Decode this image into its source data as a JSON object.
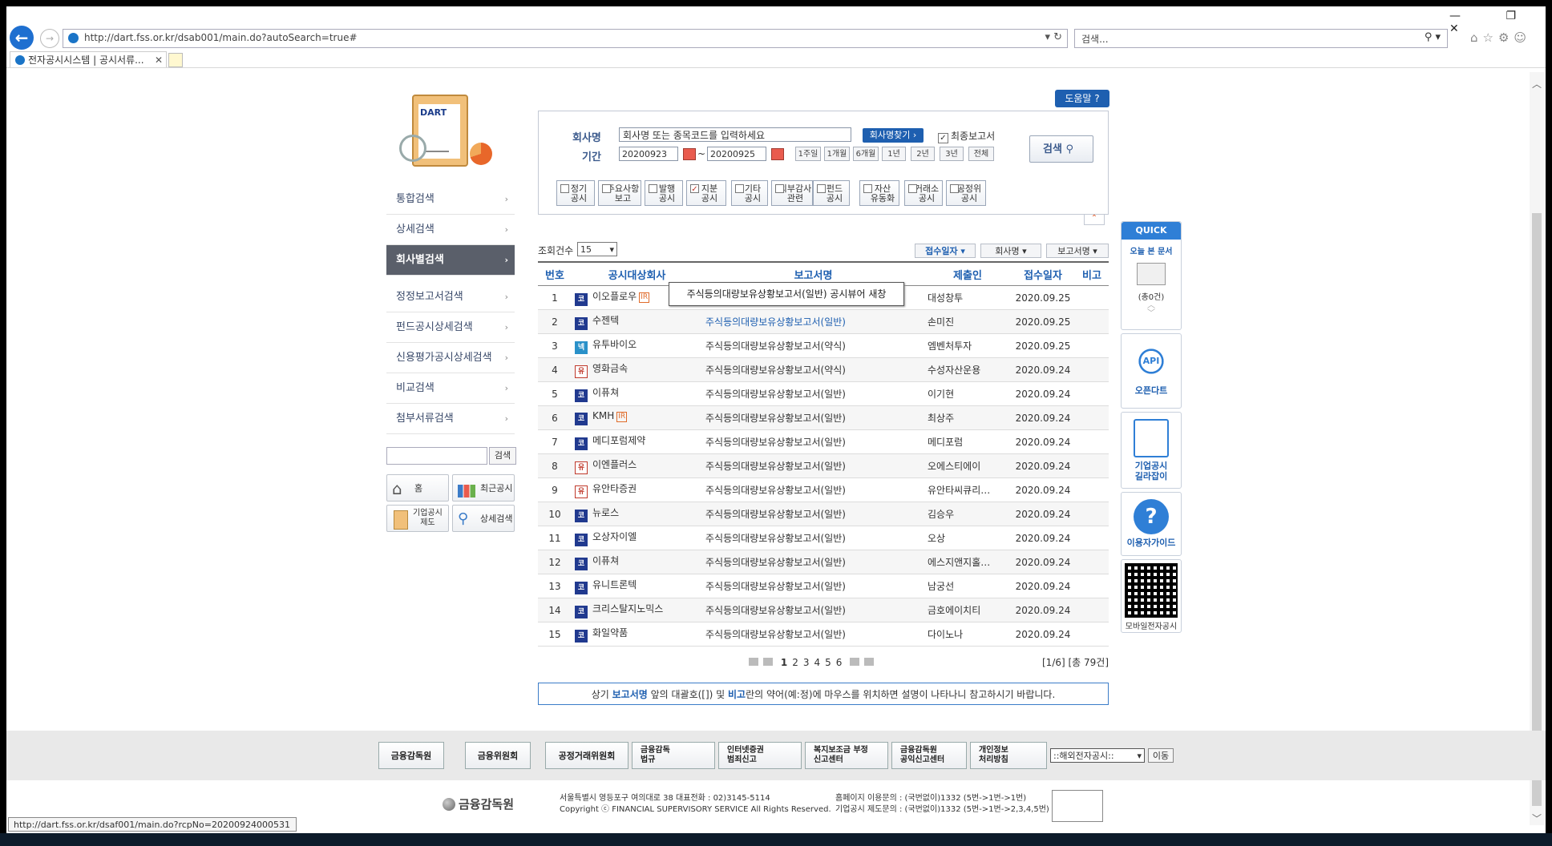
{
  "browser": {
    "url": "http://dart.fss.or.kr/dsab001/main.do?autoSearch=true#",
    "search_placeholder": "검색...",
    "tab_title": "전자공시시스템 | 공시서류...",
    "status_url": "http://dart.fss.or.kr/dsaf001/main.do?rcpNo=20200924000531"
  },
  "logo": {
    "text": "DART"
  },
  "sidebar": {
    "items": [
      {
        "label": "통합검색"
      },
      {
        "label": "상세검색"
      },
      {
        "label": "회사별검색"
      },
      {
        "label": "정정보고서검색"
      },
      {
        "label": "펀드공시상세검색"
      },
      {
        "label": "신용평가공시상세검색"
      },
      {
        "label": "비교검색"
      },
      {
        "label": "첨부서류검색"
      }
    ],
    "search_button": "검색",
    "quick": [
      {
        "label": "홈",
        "icon": "home-icon"
      },
      {
        "label": "최근공시",
        "icon": "bar-chart-icon"
      },
      {
        "label": "기업공시\n제도",
        "icon": "clipboard-icon"
      },
      {
        "label": "상세검색",
        "icon": "magnifier-icon"
      }
    ]
  },
  "search": {
    "help_label": "도움말",
    "company_label": "회사명",
    "company_placeholder": "회사명 또는 종목코드를 입력하세요",
    "find_company": "회사명찾기",
    "final_report": "최종보고서",
    "period_label": "기간",
    "date_from": "20200923",
    "date_to": "20200925",
    "tilde": "~",
    "periods": [
      "1주일",
      "1개월",
      "6개월",
      "1년",
      "2년",
      "3년",
      "전체"
    ],
    "search_button": "검색",
    "types": [
      {
        "l1": "정기",
        "l2": "공시",
        "checked": false
      },
      {
        "l1": "주요사항",
        "l2": "보고",
        "checked": false
      },
      {
        "l1": "발행",
        "l2": "공시",
        "checked": false
      },
      {
        "l1": "지분",
        "l2": "공시",
        "checked": true
      },
      {
        "l1": "기타",
        "l2": "공시",
        "checked": false
      },
      {
        "l1": "외부감사",
        "l2": "관련",
        "checked": false
      },
      {
        "l1": "펀드",
        "l2": "공시",
        "checked": false
      },
      {
        "l1": "자산",
        "l2": "유동화",
        "checked": false
      },
      {
        "l1": "거래소",
        "l2": "공시",
        "checked": false
      },
      {
        "l1": "공정위",
        "l2": "공시",
        "checked": false
      }
    ]
  },
  "results": {
    "count_label": "조회건수",
    "count_value": "15",
    "sort": [
      "접수일자",
      "회사명",
      "보고서명"
    ],
    "headers": [
      "번호",
      "공시대상회사",
      "보고서명",
      "제출인",
      "접수일자",
      "비고"
    ],
    "tooltip": "주식등의대량보유상황보고서(일반) 공시뷰어 새창",
    "rows": [
      {
        "no": "1",
        "mk": "코",
        "mkc": "k",
        "company": "이오플로우",
        "ir": true,
        "report": "",
        "submitter": "대성창투",
        "date": "2020.09.25"
      },
      {
        "no": "2",
        "mk": "코",
        "mkc": "k",
        "company": "수젠텍",
        "ir": false,
        "report": "주식등의대량보유상황보고서(일반)",
        "link": true,
        "submitter": "손미진",
        "date": "2020.09.25"
      },
      {
        "no": "3",
        "mk": "넥",
        "mkc": "ks",
        "company": "유투바이오",
        "ir": false,
        "report": "주식등의대량보유상황보고서(약식)",
        "submitter": "엠벤처투자",
        "date": "2020.09.25"
      },
      {
        "no": "4",
        "mk": "유",
        "mkc": "u",
        "company": "영화금속",
        "ir": false,
        "report": "주식등의대량보유상황보고서(약식)",
        "submitter": "수성자산운용",
        "date": "2020.09.24"
      },
      {
        "no": "5",
        "mk": "코",
        "mkc": "k",
        "company": "이퓨쳐",
        "ir": false,
        "report": "주식등의대량보유상황보고서(일반)",
        "submitter": "이기현",
        "date": "2020.09.24"
      },
      {
        "no": "6",
        "mk": "코",
        "mkc": "k",
        "company": "KMH",
        "ir": true,
        "report": "주식등의대량보유상황보고서(일반)",
        "submitter": "최상주",
        "date": "2020.09.24"
      },
      {
        "no": "7",
        "mk": "코",
        "mkc": "k",
        "company": "메디포럼제약",
        "ir": false,
        "report": "주식등의대량보유상황보고서(일반)",
        "submitter": "메디포럼",
        "date": "2020.09.24"
      },
      {
        "no": "8",
        "mk": "유",
        "mkc": "u",
        "company": "이엔플러스",
        "ir": false,
        "report": "주식등의대량보유상황보고서(일반)",
        "submitter": "오에스티에이",
        "date": "2020.09.24"
      },
      {
        "no": "9",
        "mk": "유",
        "mkc": "u",
        "company": "유안타증권",
        "ir": false,
        "report": "주식등의대량보유상황보고서(일반)",
        "submitter": "유안타씨큐리…",
        "date": "2020.09.24"
      },
      {
        "no": "10",
        "mk": "코",
        "mkc": "k",
        "company": "뉴로스",
        "ir": false,
        "report": "주식등의대량보유상황보고서(일반)",
        "submitter": "김승우",
        "date": "2020.09.24"
      },
      {
        "no": "11",
        "mk": "코",
        "mkc": "k",
        "company": "오상자이엘",
        "ir": false,
        "report": "주식등의대량보유상황보고서(일반)",
        "submitter": "오상",
        "date": "2020.09.24"
      },
      {
        "no": "12",
        "mk": "코",
        "mkc": "k",
        "company": "이퓨쳐",
        "ir": false,
        "report": "주식등의대량보유상황보고서(일반)",
        "submitter": "에스지앤지홀…",
        "date": "2020.09.24"
      },
      {
        "no": "13",
        "mk": "코",
        "mkc": "k",
        "company": "유니트론텍",
        "ir": false,
        "report": "주식등의대량보유상황보고서(일반)",
        "submitter": "남궁선",
        "date": "2020.09.24"
      },
      {
        "no": "14",
        "mk": "코",
        "mkc": "k",
        "company": "크리스탈지노믹스",
        "ir": false,
        "report": "주식등의대량보유상황보고서(일반)",
        "submitter": "금호에이치티",
        "date": "2020.09.24"
      },
      {
        "no": "15",
        "mk": "코",
        "mkc": "k",
        "company": "화일약품",
        "ir": false,
        "report": "주식등의대량보유상황보고서(일반)",
        "submitter": "다이노나",
        "date": "2020.09.24"
      }
    ],
    "pages": [
      "1",
      "2",
      "3",
      "4",
      "5",
      "6"
    ],
    "page_total": "[1/6] [총 79건]",
    "note_pre": "상기 ",
    "note_b1": "보고서명",
    "note_mid1": " 앞의 대괄호([]) 및 ",
    "note_b2": "비고",
    "note_post": "란의 약어(예:정)에 마우스를 위치하면 설명이 나타나니 참고하시기 바랍니다."
  },
  "quick_panel": {
    "header": "QUICK",
    "title": "오늘 본 문서",
    "count": "(총0건)",
    "cards": [
      {
        "label": "오픈다트",
        "icon": "api-icon"
      },
      {
        "label": "기업공시\n길라잡이",
        "icon": "document-search-icon"
      },
      {
        "label": "이용자가이드",
        "icon": "help-icon"
      }
    ],
    "qr_label": "모바일전자공시"
  },
  "footer": {
    "links": [
      "금융감독원",
      "금융위원회",
      "공정거래위원회",
      "금융감독\n법규",
      "인터넷증권\n범죄신고",
      "복지보조금 부정\n신고센터",
      "금융감독원\n공익신고센터",
      "개인정보\n처리방침"
    ],
    "select_label": "::해외전자공시::",
    "move_label": "이동",
    "logo": "금융감독원",
    "address": "서울특별시 영등포구 여의대로 38   대표전화 : 02)3145-5114",
    "copyright": "Copyright ⓒ FINANCIAL SUPERVISORY SERVICE All Rights Reserved.",
    "contact1": "홈페이지 이용문의 : (국번없이)1332 (5번->1번->1번)",
    "contact2": "기업공시 제도문의 : (국번없이)1332 (5번->1번->2,3,4,5번)"
  }
}
